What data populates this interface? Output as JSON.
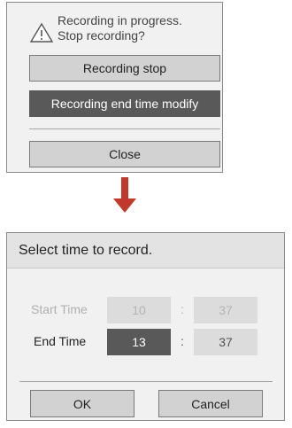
{
  "popup1": {
    "message": "Recording in progress. Stop recording?",
    "stop_label": "Recording stop",
    "end_modify_label": "Recording end time modify",
    "close_label": "Close",
    "warning_icon": "warning-triangle-icon"
  },
  "arrow_icon": "arrow-down-icon",
  "popup2": {
    "title": "Select time to record.",
    "start_label": "Start Time",
    "start_hour": "10",
    "start_minute": "37",
    "end_label": "End Time",
    "end_hour": "13",
    "end_minute": "37",
    "colon": ":",
    "ok_label": "OK",
    "cancel_label": "Cancel"
  },
  "colors": {
    "panel_bg": "#f1f1f1",
    "button_bg": "#d2d2d2",
    "selected_bg": "#595959",
    "arrow": "#c0392b"
  }
}
